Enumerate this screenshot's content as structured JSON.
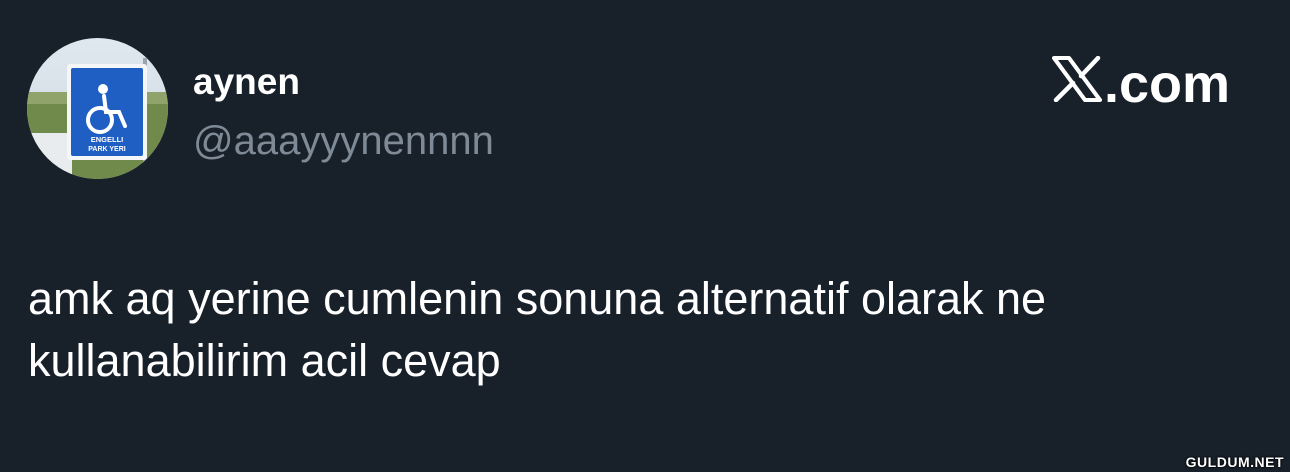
{
  "author": {
    "display_name": "aynen",
    "handle": "@aaayyynennnn",
    "avatar_icon": "disabled-parking-sign-icon",
    "avatar_sign_text": "ENGELLI PARK YERI"
  },
  "brand": {
    "site": ".com",
    "logo_icon": "x-logo-icon"
  },
  "tweet": {
    "text": "amk aq yerine cumlenin sonuna alternatif olarak ne kullanabilirim acil cevap"
  },
  "watermark": "GULDUM.NET",
  "colors": {
    "background": "#18202a",
    "text": "#ffffff",
    "handle": "#7e8a95",
    "sign_blue": "#1f5fc4"
  }
}
